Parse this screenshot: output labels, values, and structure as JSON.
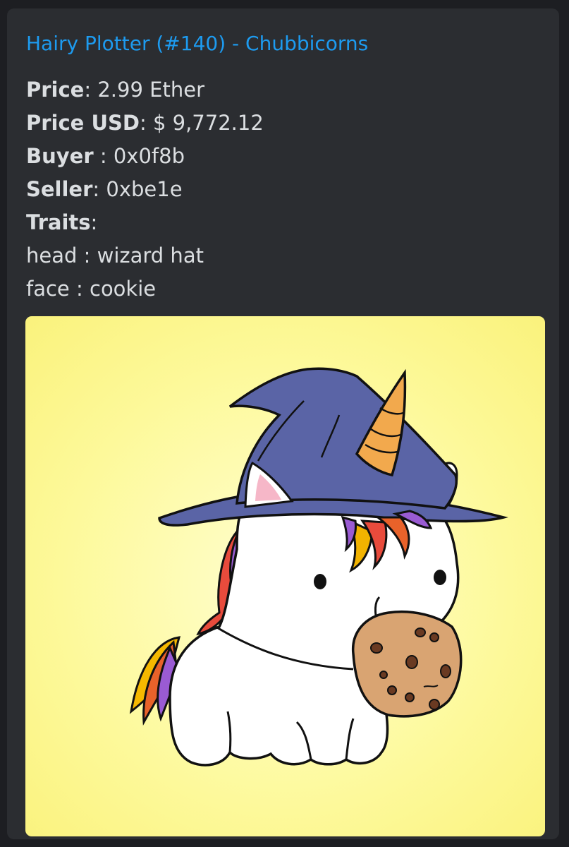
{
  "embed": {
    "title": "Hairy Plotter (#140) - Chubbicorns",
    "fields": {
      "price_label": "Price",
      "price_value": "2.99 Ether",
      "price_usd_label": "Price USD",
      "price_usd_value": "$ 9,772.12",
      "buyer_label": "Buyer",
      "buyer_value": "0x0f8b",
      "seller_label": "Seller",
      "seller_value": "0xbe1e",
      "traits_label": "Traits"
    },
    "traits": [
      {
        "type": "head",
        "value": "wizard hat"
      },
      {
        "type": "face",
        "value": "cookie"
      }
    ],
    "image": {
      "subject": "unicorn-wearing-wizard-hat-holding-cookie",
      "colors": {
        "background": "#fdf99a",
        "hat": "#5a64a6",
        "horn": "#f2a94d",
        "cookie": "#d9a472",
        "body": "#ffffff"
      }
    }
  }
}
